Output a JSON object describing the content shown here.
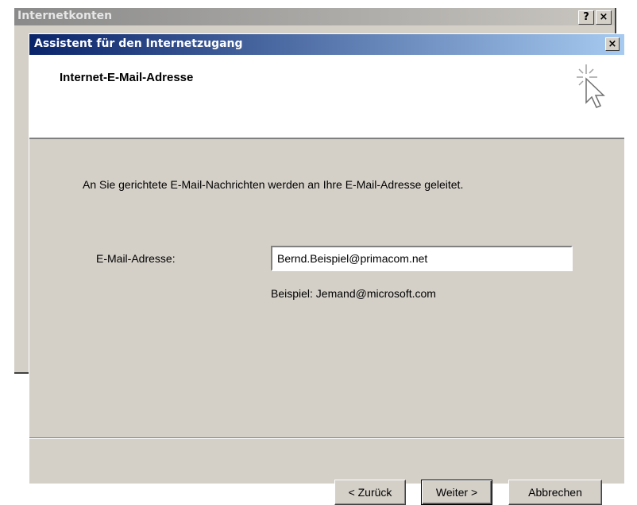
{
  "background_window": {
    "title": "Internetkonten",
    "help_label": "?",
    "close_label": "×"
  },
  "dialog": {
    "title": "Assistent für den Internetzugang",
    "close_label": "×",
    "header_title": "Internet-E-Mail-Adresse",
    "wizard_icon": "cursor-sparkle-icon"
  },
  "content": {
    "description": "An Sie gerichtete E-Mail-Nachrichten werden an Ihre E-Mail-Adresse geleitet.",
    "email_label": "E-Mail-Adresse:",
    "email_value": "Bernd.Beispiel@primacom.net",
    "example": "Beispiel: Jemand@microsoft.com"
  },
  "buttons": {
    "back": "< Zurück",
    "next": "Weiter >",
    "cancel": "Abbrechen"
  },
  "colors": {
    "titlebar_start": "#0a246a",
    "titlebar_end": "#a6caf0",
    "dialog_bg": "#d4d0c8"
  }
}
